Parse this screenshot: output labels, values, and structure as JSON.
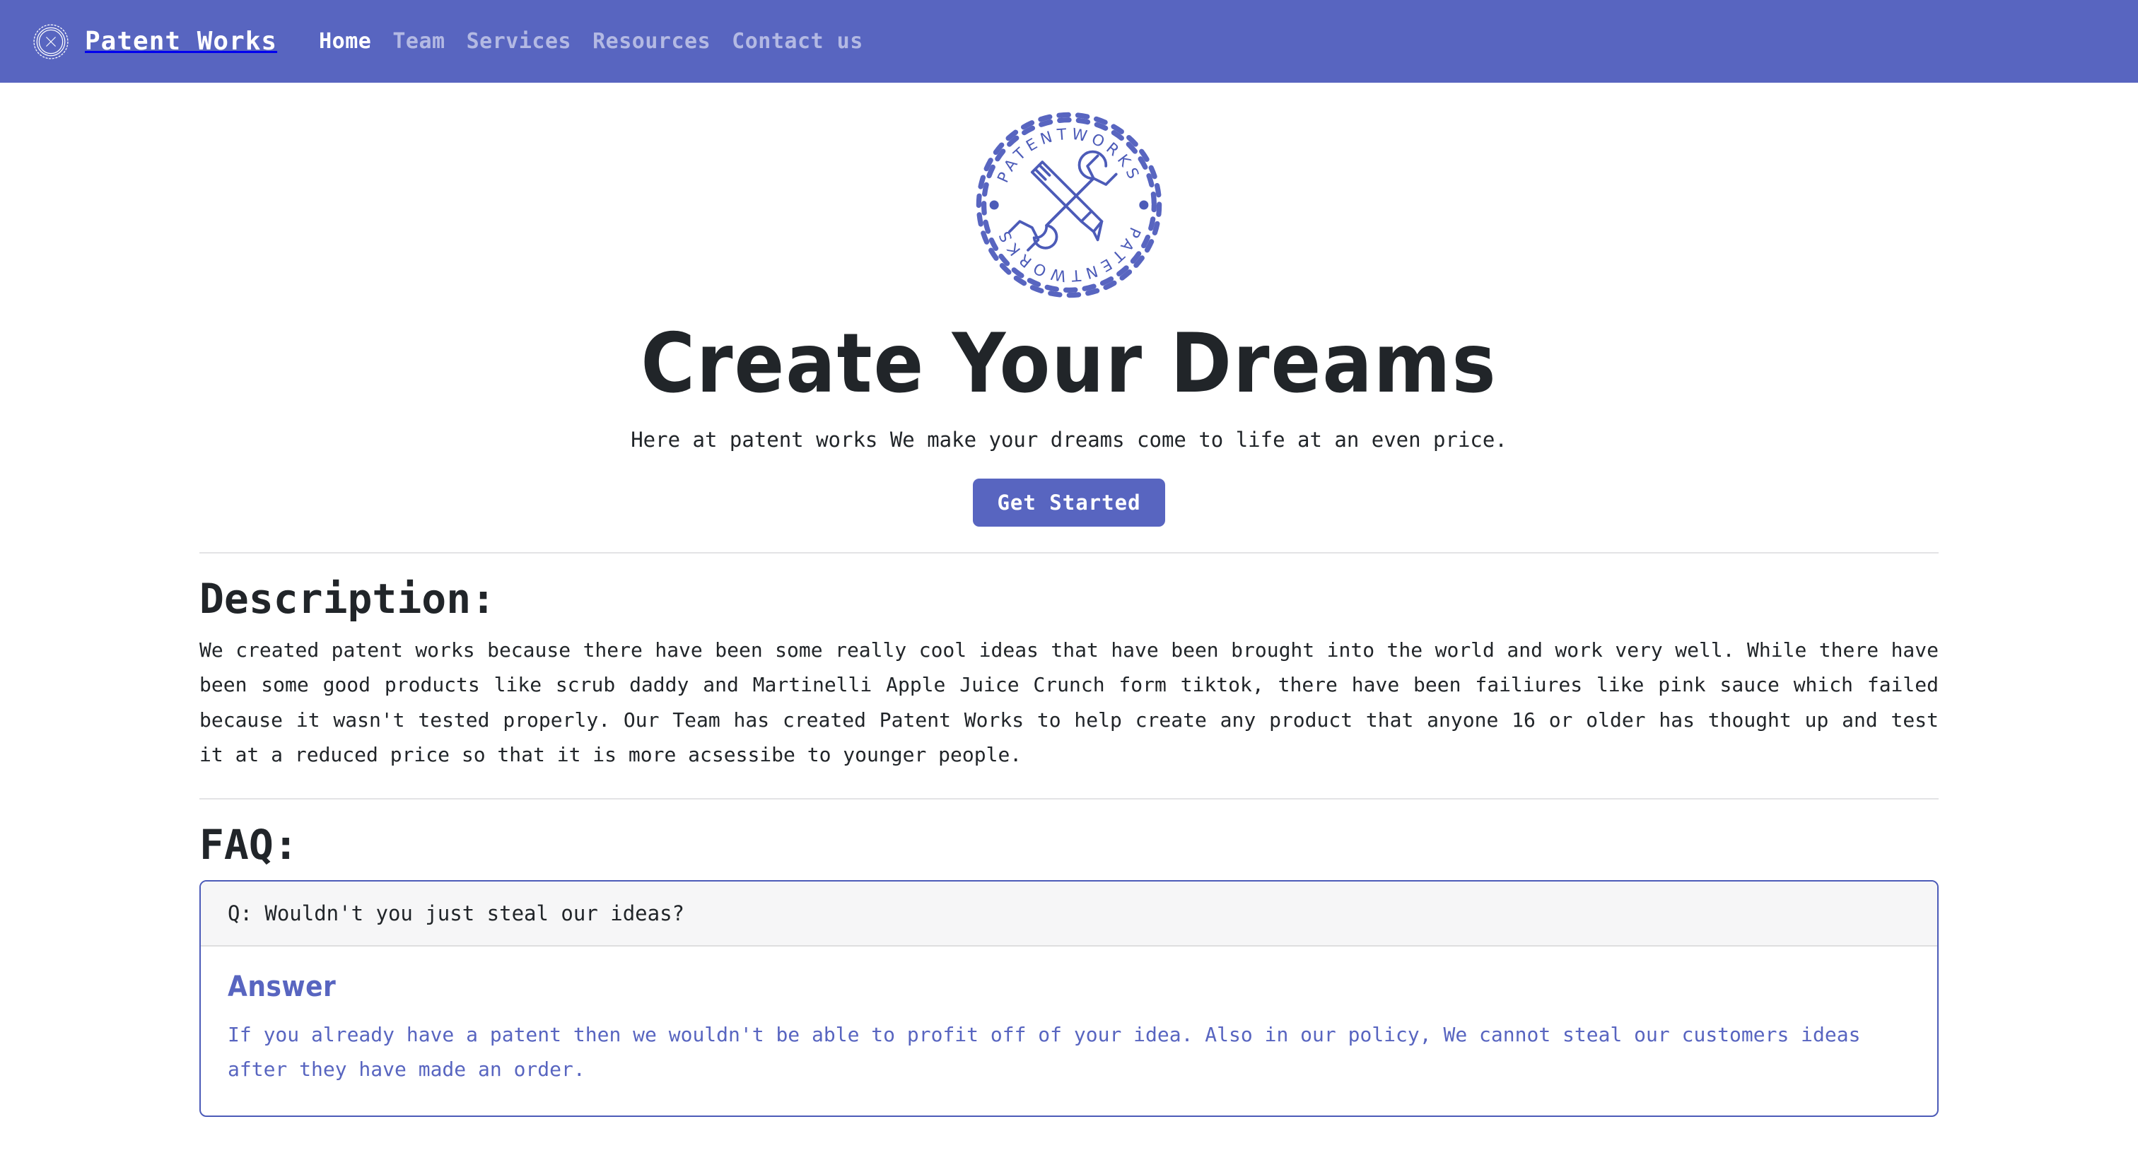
{
  "colors": {
    "brand_blue": "#5865c0",
    "card_border": "#4c5bb8",
    "card_header_bg": "#f6f6f7",
    "text_dark": "#212529",
    "divider": "#e3e3e5"
  },
  "navbar": {
    "logo_icon": "patentworks-badge-icon",
    "brand": "Patent Works",
    "links": [
      {
        "label": "Home",
        "active": true
      },
      {
        "label": "Team",
        "active": false
      },
      {
        "label": "Services",
        "active": false
      },
      {
        "label": "Resources",
        "active": false
      },
      {
        "label": "Contact us",
        "active": false
      }
    ]
  },
  "hero": {
    "logo_icon": "patentworks-badge-icon",
    "logo_text_top": "PATENTWORKS",
    "logo_text_bottom": "PATENTWORKS",
    "logo_center_icon": "pencil-and-wrench-crossed-icon",
    "title": "Create Your Dreams",
    "subtitle": "Here at patent works We make your dreams come to life at an even price.",
    "cta_label": "Get Started"
  },
  "description": {
    "title": "Description:",
    "body": "We created patent works because there have been some really cool ideas that have been brought into the world and work very well. While there have been some good products like scrub daddy and Martinelli Apple Juice Crunch form tiktok, there have been failiures like pink sauce which failed because it wasn't tested properly. Our Team has created Patent Works to help create any product that anyone 16 or older has thought up and test it at a reduced price so that it is more acsessibe to younger people."
  },
  "faq": {
    "title": "FAQ:",
    "question": "Q: Wouldn't you just steal our ideas?",
    "answer_label": "Answer",
    "answer_body": "If you already have a patent then we wouldn't be able to profit off of your idea. Also in our policy, We cannot steal our customers ideas after they have made an order."
  }
}
